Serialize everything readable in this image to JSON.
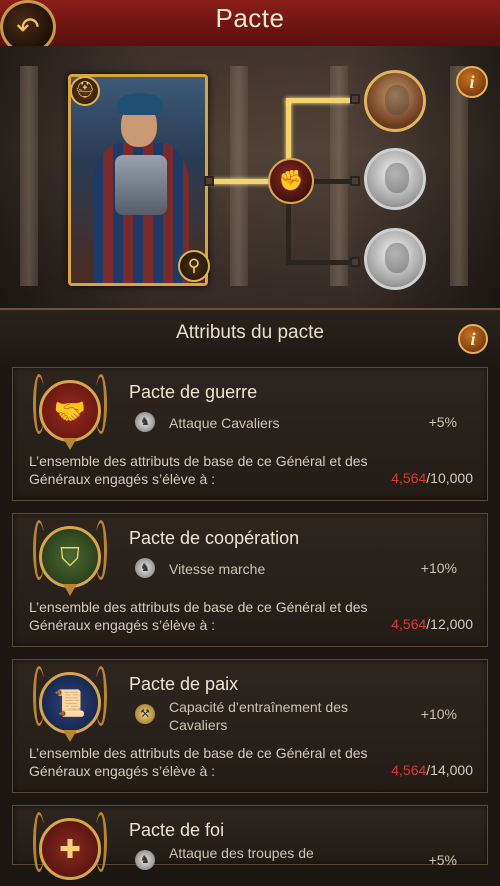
{
  "header": {
    "title": "Pacte"
  },
  "section": {
    "title": "Attributs du pacte"
  },
  "info_label": "i",
  "pacts": [
    {
      "name": "Pacte de guerre",
      "stat_label": "Attaque Cavaliers",
      "stat_value": "+5%",
      "description": "L’ensemble des attributs de base de ce Général et des Généraux engagés s’élève à :",
      "current": "4,564",
      "target": "/10,000",
      "emblem_color": "#7a1e16",
      "emblem_icon": "handshake-icon"
    },
    {
      "name": "Pacte de coopération",
      "stat_label": "Vitesse marche",
      "stat_value": "+10%",
      "description": "L’ensemble des attributs de base de ce Général et des Généraux engagés s’élève à :",
      "current": "4,564",
      "target": "/12,000",
      "emblem_color": "#2f4a25",
      "emblem_icon": "shield-icon"
    },
    {
      "name": "Pacte de paix",
      "stat_label": "Capacité d’entraînement des Cavaliers",
      "stat_value": "+10%",
      "description": "L’ensemble des attributs de base de ce Général et des Généraux engagés s’élève à :",
      "current": "4,564",
      "target": "/14,000",
      "emblem_color": "#1e2f5a",
      "emblem_icon": "scroll-icon"
    },
    {
      "name": "Pacte de foi",
      "stat_label": "Attaque des troupes de",
      "stat_value": "+5%",
      "description": "",
      "current": "",
      "target": "",
      "emblem_color": "#6a1e16",
      "emblem_icon": "cross-icon"
    }
  ]
}
